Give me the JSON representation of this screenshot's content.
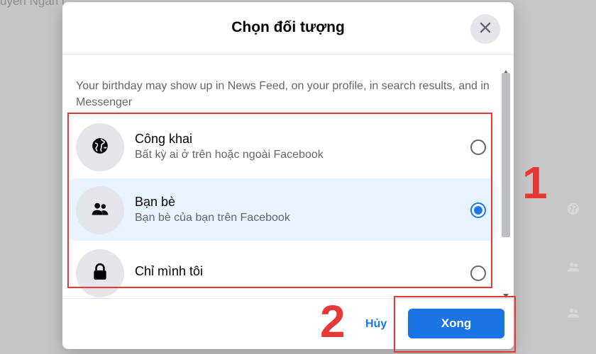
{
  "background": {
    "name_text": "uyen Ngan (...",
    "icons": [
      "globe-icon",
      "friends-icon",
      "friends-icon"
    ]
  },
  "dialog": {
    "title": "Chọn đối tượng",
    "close_icon": "close-icon",
    "description": "Your birthday may show up in News Feed, on your profile, in search results, and in Messenger",
    "options": [
      {
        "icon": "globe-icon",
        "title": "Công khai",
        "subtitle": "Bất kỳ ai ở trên hoặc ngoài Facebook",
        "selected": false
      },
      {
        "icon": "friends-icon",
        "title": "Bạn bè",
        "subtitle": "Bạn bè của bạn trên Facebook",
        "selected": true
      },
      {
        "icon": "lock-icon",
        "title": "Chỉ mình tôi",
        "subtitle": "",
        "selected": false
      }
    ],
    "footer": {
      "cancel_label": "Hủy",
      "done_label": "Xong"
    }
  },
  "annotations": {
    "step1": "1",
    "step2": "2",
    "color": "#e53935"
  },
  "colors": {
    "accent": "#1877f2",
    "selected_bg": "#e7f3ff",
    "text_primary": "#050505",
    "text_secondary": "#65676b"
  }
}
